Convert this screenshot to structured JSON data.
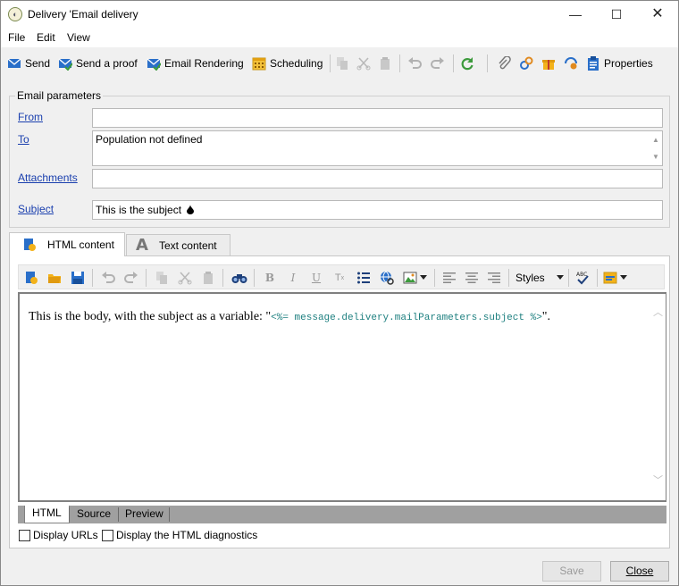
{
  "window": {
    "title": "Delivery 'Email delivery",
    "minimize": "—",
    "maximize": "☐",
    "close": "✕"
  },
  "menu": [
    "File",
    "Edit",
    "View"
  ],
  "toolbar": {
    "send": "Send",
    "send_proof": "Send a proof",
    "email_rendering": "Email Rendering",
    "scheduling": "Scheduling",
    "properties": "Properties"
  },
  "params": {
    "legend": "Email parameters",
    "from_label": "From",
    "from_value": "",
    "to_label": "To",
    "to_value": "Population not defined",
    "attachments_label": "Attachments",
    "attachments_value": "",
    "subject_label": "Subject",
    "subject_value": "This is the subject"
  },
  "tabs": {
    "html": "HTML content",
    "text": "Text content"
  },
  "editor": {
    "styles_label": "Styles",
    "body_text": "This is the body, with the subject as a variable: \"",
    "body_code": "<%= message.delivery.mailParameters.subject %>",
    "body_end": "\"."
  },
  "view_tabs": [
    "HTML",
    "Source",
    "Preview"
  ],
  "options": {
    "display_urls": "Display URLs",
    "display_diag": "Display the HTML diagnostics"
  },
  "buttons": {
    "save": "Save",
    "close": "Close"
  },
  "colors": {
    "link": "#1a3fae",
    "code": "#1f8080",
    "accent_blue": "#2a6fc9",
    "accent_green": "#3c9a3c"
  }
}
